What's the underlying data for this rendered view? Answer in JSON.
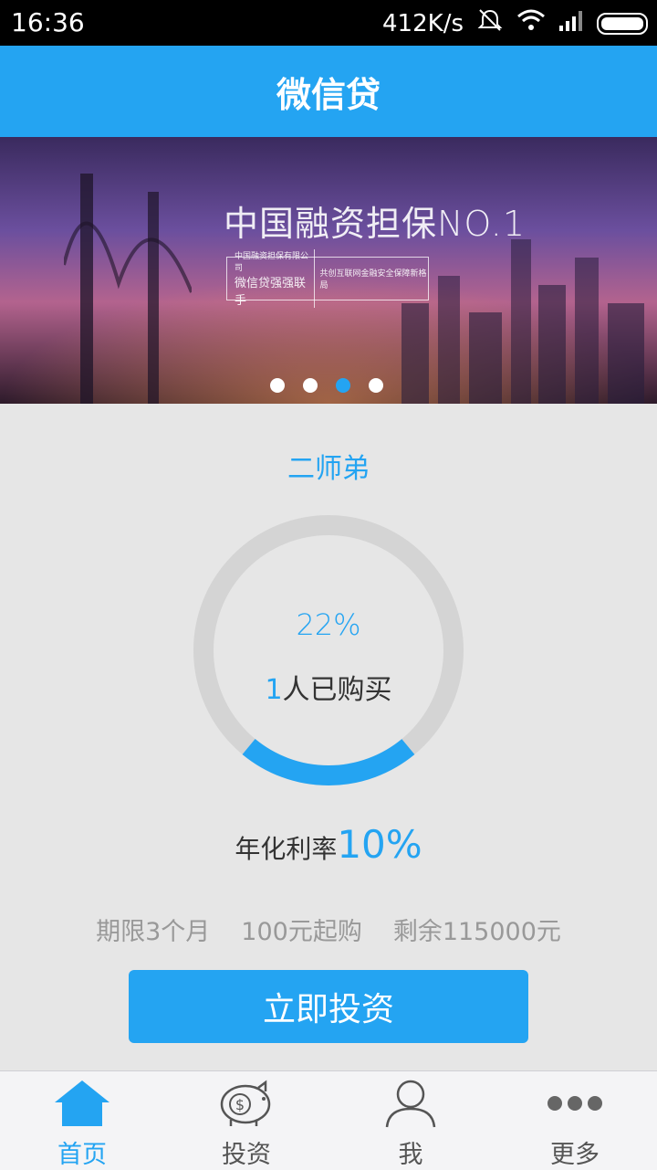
{
  "status_bar": {
    "time": "16:36",
    "network_speed": "412K/s"
  },
  "app": {
    "title": "微信贷"
  },
  "banner": {
    "headline": "中国融资担保NO.1",
    "box_line1": "中国融资担保有限公司",
    "box_line2": "微信贷强强联手",
    "box_right": "共创互联网金融安全保障新格局",
    "slide_count": 4,
    "active_slide": 3
  },
  "product": {
    "name": "二师弟",
    "progress_percent_text": "22%",
    "progress_value": 0.22,
    "buyers_count": "1",
    "buyers_suffix": "人已购买",
    "rate_label": "年化利率",
    "rate_value": "10%",
    "term": "期限3个月",
    "min_purchase": "100元起购",
    "remaining": "剩余115000元",
    "invest_button": "立即投资"
  },
  "tabs": [
    {
      "label": "首页",
      "icon": "home-icon",
      "active": true
    },
    {
      "label": "投资",
      "icon": "piggy-bank-icon",
      "active": false
    },
    {
      "label": "我",
      "icon": "user-icon",
      "active": false
    },
    {
      "label": "更多",
      "icon": "more-icon",
      "active": false
    }
  ],
  "colors": {
    "accent": "#24a4f2",
    "ring_track": "#d4d4d4",
    "background": "#e6e6e6"
  }
}
